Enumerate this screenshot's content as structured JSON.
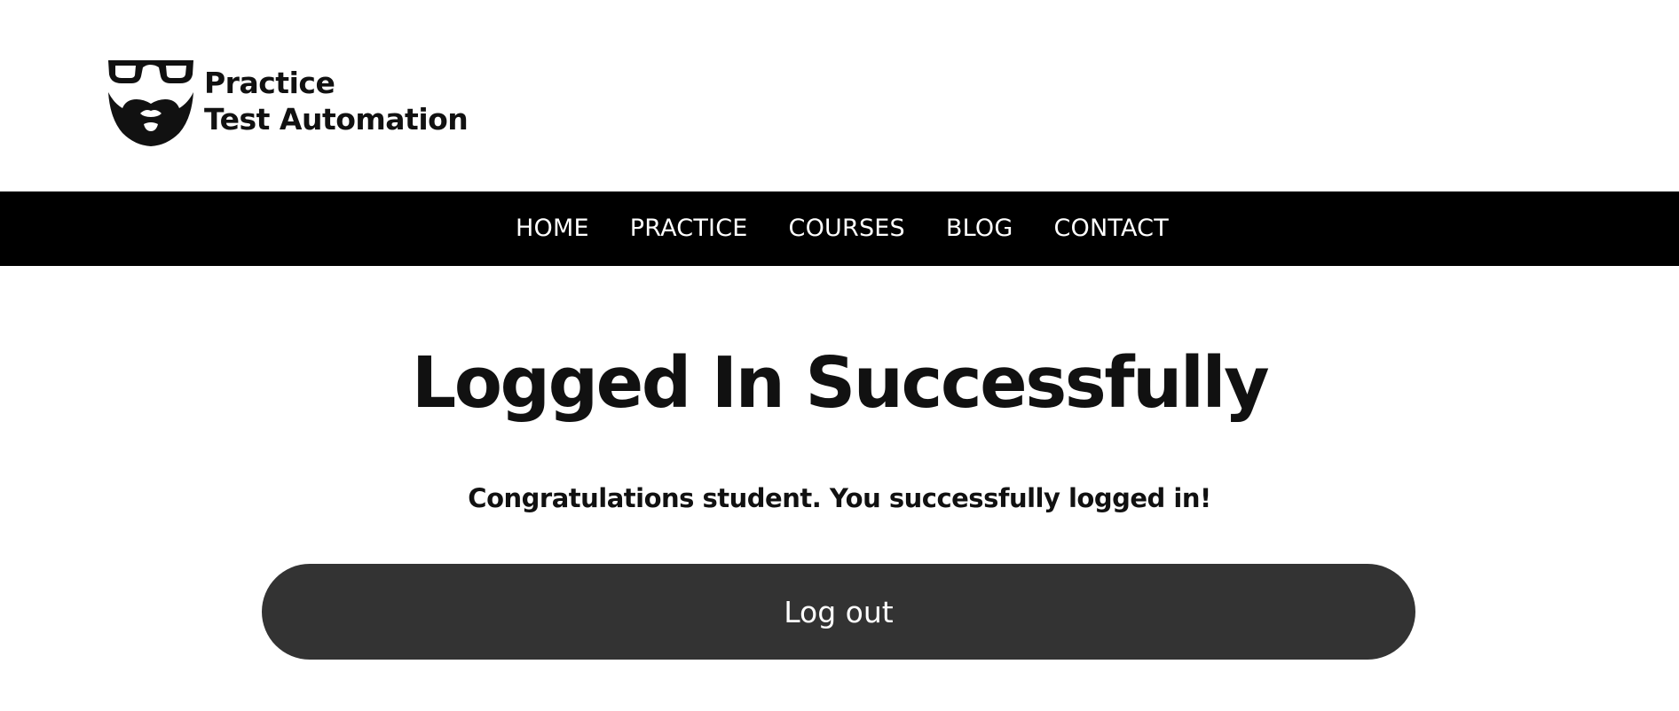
{
  "header": {
    "logo": {
      "line1": "Practice",
      "line2": "Test Automation",
      "icon": "glasses-beard-icon"
    }
  },
  "nav": {
    "items": [
      {
        "label": "HOME"
      },
      {
        "label": "PRACTICE"
      },
      {
        "label": "COURSES"
      },
      {
        "label": "BLOG"
      },
      {
        "label": "CONTACT"
      }
    ]
  },
  "main": {
    "title": "Logged In Successfully",
    "message": "Congratulations student. You successfully logged in!",
    "logout_label": "Log out"
  },
  "colors": {
    "nav_background": "#000000",
    "button_background": "#333333",
    "text": "#111111"
  }
}
